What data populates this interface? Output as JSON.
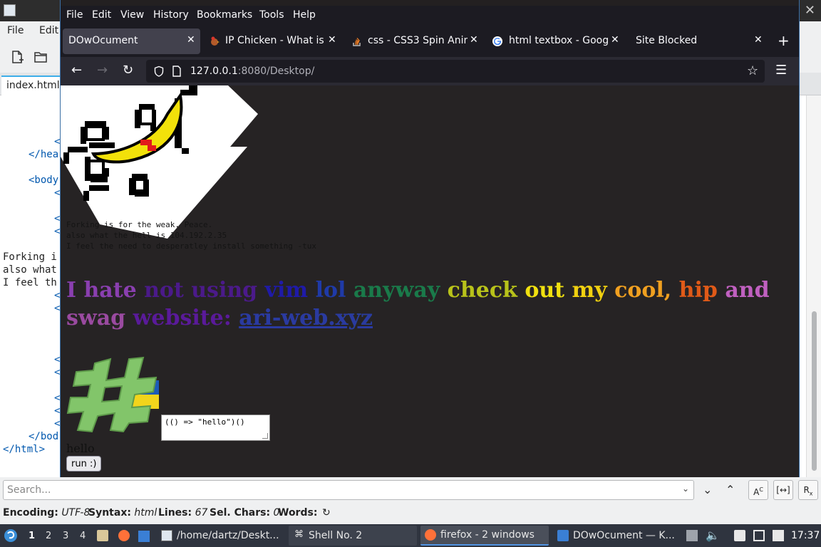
{
  "kate": {
    "menu": [
      "File",
      "Edit"
    ],
    "doc_tab": "index.html",
    "code_lines": [
      {
        "text": "<",
        "cls": "tag-blue",
        "indent": 10
      },
      {
        "text": "</hea",
        "cls": "tag-blue",
        "indent": 5
      },
      {
        "text": "<body",
        "cls": "tag-blue",
        "indent": 5
      },
      {
        "text": "<",
        "cls": "tag-blue",
        "indent": 10
      },
      {
        "text": "<",
        "cls": "tag-blue",
        "indent": 10
      },
      {
        "text": "<",
        "cls": "tag-blue",
        "indent": 10
      },
      {
        "text": "Forking i",
        "cls": "plain",
        "indent": 0
      },
      {
        "text": "also what",
        "cls": "plain",
        "indent": 0
      },
      {
        "text": "I feel th",
        "cls": "plain",
        "indent": 0
      },
      {
        "text": "<",
        "cls": "tag-blue",
        "indent": 10
      },
      {
        "text": "<",
        "cls": "tag-blue",
        "indent": 10
      },
      {
        "text": "<",
        "cls": "tag-blue",
        "indent": 10
      },
      {
        "text": "<",
        "cls": "tag-blue",
        "indent": 10
      },
      {
        "text": "<",
        "cls": "tag-blue",
        "indent": 10
      },
      {
        "text": "<",
        "cls": "tag-blue",
        "indent": 10
      },
      {
        "text": "<",
        "cls": "tag-blue",
        "indent": 10
      },
      {
        "text": "</bod",
        "cls": "tag-blue",
        "indent": 5
      },
      {
        "text": "</html>",
        "cls": "tag-blue",
        "indent": 0
      }
    ],
    "search_placeholder": "Search...",
    "status": {
      "encoding_label": "Encoding:",
      "encoding": "UTF-8",
      "syntax_label": "Syntax:",
      "syntax": "html",
      "lines_label": "Lines:",
      "lines": "67",
      "sel_label": "Sel. Chars:",
      "sel": "0",
      "words_label": "Words:"
    }
  },
  "firefox": {
    "menu": [
      "File",
      "Edit",
      "View",
      "History",
      "Bookmarks",
      "Tools",
      "Help"
    ],
    "tabs": [
      {
        "label": "DOwOcument",
        "active": true
      },
      {
        "label": "IP Chicken - What is m",
        "active": false
      },
      {
        "label": "css - CSS3 Spin Anim",
        "active": false
      },
      {
        "label": "html textbox - Google",
        "active": false
      },
      {
        "label": "Site Blocked",
        "active": false
      }
    ],
    "url_host": "127.0.0.1",
    "url_path": ":8080/Desktop/",
    "page": {
      "pre_lines": [
        "Forking is for the weak. Peace.",
        "also what the hell is 104.192.2.35",
        "I feel the need to desperatley install something -tux"
      ],
      "rainbow_words": [
        {
          "text": "I hate ",
          "color": "#8a3fb0"
        },
        {
          "text": "not using ",
          "color": "#4b1a8a"
        },
        {
          "text": "vim ",
          "color": "#1f1aa8"
        },
        {
          "text": "lol ",
          "color": "#1f3aa8"
        },
        {
          "text": "anyway ",
          "color": "#1a7a4a"
        },
        {
          "text": "check ",
          "color": "#b8c21a"
        },
        {
          "text": "out ",
          "color": "#f0e010"
        },
        {
          "text": "my ",
          "color": "#f0d010"
        },
        {
          "text": "cool, ",
          "color": "#f0a020"
        },
        {
          "text": "hip ",
          "color": "#e05a18"
        },
        {
          "text": "and ",
          "color": "#c060c0"
        },
        {
          "text": "swag ",
          "color": "#9a4aa0"
        },
        {
          "text": "website: ",
          "color": "#5a1a9a"
        }
      ],
      "link_text": "ari-web.xyz",
      "textarea_value": "(() => \"hello\")()",
      "output": "hello",
      "run_button": "run :)"
    }
  },
  "taskbar": {
    "desktops": [
      "1",
      "2",
      "3",
      "4"
    ],
    "tasks": [
      {
        "label": "/home/dartz/Deskt...",
        "active": false
      },
      {
        "label": "Shell No. 2",
        "active": false
      },
      {
        "label": "firefox - 2 windows",
        "active": true
      },
      {
        "label": "DOwOcument — K...",
        "active": false
      }
    ],
    "clock": "17:37"
  }
}
